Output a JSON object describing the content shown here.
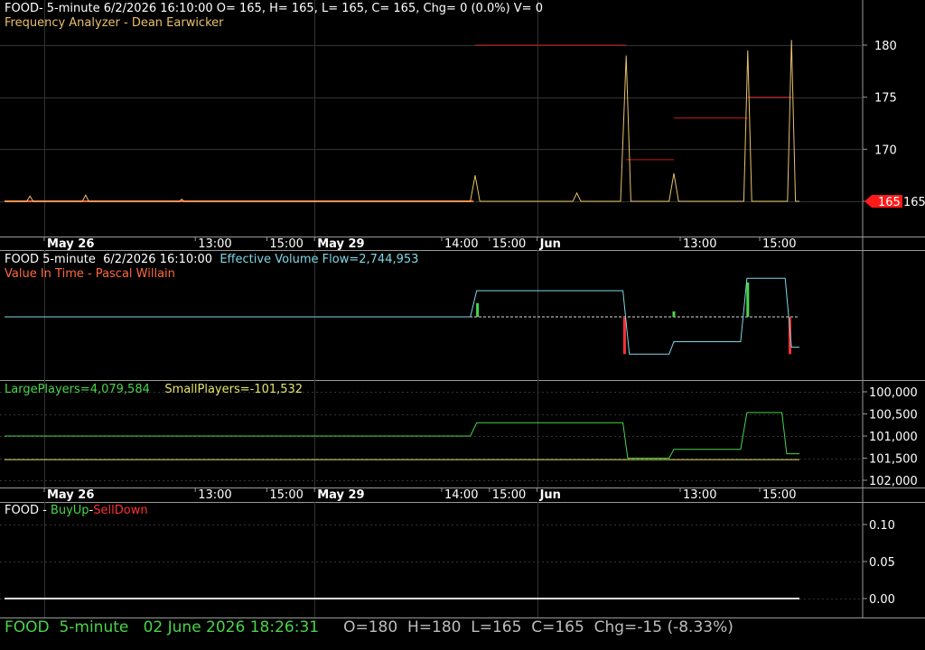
{
  "colors": {
    "background": "#000000",
    "grid": "#333333",
    "separator": "#9a9a9a",
    "axis_text": "#ffffff",
    "price_line": "#e8c06a",
    "price_baseline": "#ff6a3a",
    "red_levels": "#c81e1e",
    "evf_line": "#7fd6e6",
    "green": "#49d44a",
    "yellow": "#e6e36a",
    "red": "#ff3030",
    "last_price_tag": "#ff1a1a"
  },
  "panel1": {
    "title": "FOOD- 5-minute 6/2/2026 16:10:00 O= 165, H= 165, L= 165, C= 165, Chg= 0 (0.0%) V= 0",
    "subtitle": "Frequency Analyzer - Dean Earwicker"
  },
  "panel2": {
    "title_prefix": "FOOD 5-minute  6/2/2026 16:10:00",
    "evf_label": "Effective Volume Flow=2,744,953",
    "subtitle": "Value In Time - Pascal Willain"
  },
  "panel3": {
    "large_label": "LargePlayers=4,079,584",
    "small_label": "SmallPlayers=-101,532"
  },
  "panel4": {
    "symbol": "FOOD",
    "sep1": " - ",
    "buy_label": "BuyUp",
    "sep2": "-",
    "sell_label": "SellDown"
  },
  "status_bar": {
    "symbol": "FOOD",
    "interval": "5-minute",
    "datetime": "02 June 2026 18:26:31",
    "ohlc": "O=180  H=180  L=165  C=165  Chg=-15 (-8.33%)"
  },
  "chart_data": [
    {
      "type": "line",
      "name": "price",
      "ylim": [
        161,
        182
      ],
      "y_ticks": [
        "180",
        "175",
        "170",
        "165"
      ],
      "y_tick_values": [
        180,
        175,
        170,
        165
      ],
      "last_value_label": "165",
      "x_tick_labels": [
        {
          "label": "May 26",
          "bold": true
        },
        {
          "label": "13:00",
          "bold": false
        },
        {
          "label": "15:00",
          "bold": false
        },
        {
          "label": "May 29",
          "bold": true
        },
        {
          "label": "14:00",
          "bold": false
        },
        {
          "label": "15:00",
          "bold": false
        },
        {
          "label": "Jun",
          "bold": true
        },
        {
          "label": "13:00",
          "bold": false
        },
        {
          "label": "15:00",
          "bold": false
        }
      ],
      "x_range": [
        0,
        100
      ],
      "x_tick_positions": [
        5,
        24,
        33,
        39,
        55,
        61,
        67,
        85,
        95
      ],
      "vertical_grid": [
        5,
        39,
        67
      ],
      "series": [
        {
          "values": [
            [
              0,
              165
            ],
            [
              2.8,
              165
            ],
            [
              3.2,
              165.5
            ],
            [
              3.6,
              165
            ],
            [
              9.8,
              165
            ],
            [
              10.2,
              165.6
            ],
            [
              10.6,
              165
            ],
            [
              22,
              165
            ],
            [
              22.3,
              165.2
            ],
            [
              22.6,
              165
            ],
            [
              58.6,
              165
            ],
            [
              59.2,
              167.5
            ],
            [
              59.8,
              165
            ],
            [
              71.5,
              165
            ],
            [
              72,
              165.8
            ],
            [
              72.5,
              165
            ],
            [
              77.5,
              165
            ],
            [
              78.2,
              179
            ],
            [
              78.8,
              165
            ],
            [
              83.6,
              165
            ],
            [
              84.2,
              167.7
            ],
            [
              84.8,
              165
            ],
            [
              93,
              165
            ],
            [
              93.5,
              179.5
            ],
            [
              94,
              165
            ],
            [
              98.5,
              165
            ],
            [
              99,
              180.5
            ],
            [
              99.5,
              165
            ],
            [
              100,
              165
            ]
          ]
        }
      ],
      "baseline_segment": {
        "x": [
          0,
          59
        ],
        "value": 165
      },
      "level_segments": [
        {
          "x": [
            59.2,
            78.2
          ],
          "value": 180
        },
        {
          "x": [
            78.2,
            84.2
          ],
          "value": 169
        },
        {
          "x": [
            84.2,
            93.5
          ],
          "value": 173
        },
        {
          "x": [
            93.5,
            99
          ],
          "value": 175
        }
      ]
    },
    {
      "type": "line",
      "name": "Effective Volume Flow",
      "ylim": [
        -4,
        3
      ],
      "baseline": 0,
      "series": [
        {
          "name": "Effective Volume Flow",
          "values": [
            [
              0,
              0
            ],
            [
              58.6,
              0
            ],
            [
              59.4,
              1.9
            ],
            [
              77.8,
              1.9
            ],
            [
              78.6,
              -2.7
            ],
            [
              83.6,
              -2.7
            ],
            [
              84.2,
              -1.8
            ],
            [
              92.6,
              -1.8
            ],
            [
              93.4,
              2.8
            ],
            [
              98.2,
              2.8
            ],
            [
              99,
              -2.2
            ],
            [
              100,
              -2.2
            ]
          ]
        }
      ],
      "bars": [
        {
          "x": 59.5,
          "value": 1,
          "color": "green"
        },
        {
          "x": 78,
          "value": -2.7,
          "color": "red"
        },
        {
          "x": 84.2,
          "value": 0.4,
          "color": "green"
        },
        {
          "x": 93.5,
          "value": 2.5,
          "color": "green"
        },
        {
          "x": 98.8,
          "value": -2.7,
          "color": "red"
        }
      ]
    },
    {
      "type": "line",
      "name": "players",
      "ylim": [
        -102300,
        -99800
      ],
      "y_ticks": [
        "100,000",
        "100,500",
        "101,000",
        "101,500",
        "102,000"
      ],
      "y_tick_values": [
        -100000,
        -100500,
        -101000,
        -101500,
        -102000
      ],
      "series": [
        {
          "name": "LargePlayers",
          "values": [
            [
              0,
              -101000
            ],
            [
              58.6,
              -101000
            ],
            [
              59.4,
              -100700
            ],
            [
              77.8,
              -100700
            ],
            [
              78.4,
              -101500
            ],
            [
              83.6,
              -101500
            ],
            [
              84.2,
              -101300
            ],
            [
              92.6,
              -101300
            ],
            [
              93.4,
              -100470
            ],
            [
              97.8,
              -100470
            ],
            [
              98.4,
              -101400
            ],
            [
              100,
              -101400
            ]
          ]
        },
        {
          "name": "SmallPlayers",
          "values": [
            [
              0,
              -101532
            ],
            [
              100,
              -101532
            ]
          ]
        }
      ]
    },
    {
      "type": "line",
      "name": "BuyUp-SellDown",
      "ylim": [
        -0.005,
        0.115
      ],
      "y_ticks": [
        "0.10",
        "0.05",
        "0.00"
      ],
      "y_tick_values": [
        0.1,
        0.05,
        0.0
      ],
      "series": [
        {
          "name": "BuyUp",
          "values": [
            [
              0,
              0
            ],
            [
              100,
              0
            ]
          ]
        }
      ]
    }
  ]
}
